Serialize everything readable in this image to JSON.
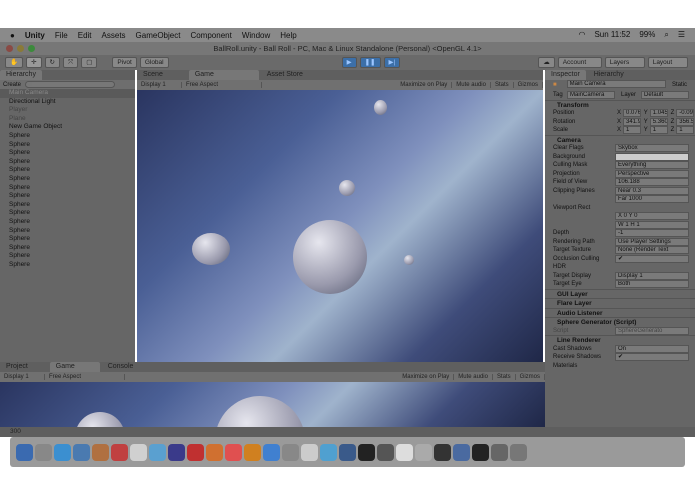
{
  "menubar": {
    "items": [
      "Unity",
      "File",
      "Edit",
      "Assets",
      "GameObject",
      "Component",
      "Window",
      "Help"
    ],
    "clock": "Sun 11:52",
    "battery": "99%"
  },
  "window_title": "BallRoll.unity - Ball Roll - PC, Mac & Linux Standalone (Personal) <OpenGL 4.1>",
  "toolbar": {
    "pivot": "Pivot",
    "global": "Global",
    "account": "Account",
    "layers": "Layers",
    "layout": "Layout"
  },
  "hierarchy": {
    "tab": "Hierarchy",
    "create": "Create",
    "search_placeholder": "All",
    "items": [
      "Main Camera",
      "Directional Light",
      "Player",
      "Plane",
      "New Game Object",
      "Sphere",
      "Sphere",
      "Sphere",
      "Sphere",
      "Sphere",
      "Sphere",
      "Sphere",
      "Sphere",
      "Sphere",
      "Sphere",
      "Sphere",
      "Sphere",
      "Sphere",
      "Sphere",
      "Sphere",
      "Sphere"
    ]
  },
  "center": {
    "tabs": [
      "Scene",
      "Game",
      "Asset Store"
    ],
    "display": "Display 1",
    "aspect": "Free Aspect",
    "buttons": [
      "Maximize on Play",
      "Mute audio",
      "Stats",
      "Gizmos"
    ]
  },
  "inspector": {
    "tabs": [
      "Inspector",
      "Hierarchy"
    ],
    "object_name": "Main Camera",
    "static": "Static",
    "tag_label": "Tag",
    "tag": "MainCamera",
    "layer_label": "Layer",
    "layer": "Default",
    "transform": {
      "title": "Transform",
      "position": [
        "0.0765",
        "1.0452",
        "-0.094"
      ],
      "rotation": [
        "341.95",
        "5.3601",
        "356.57"
      ],
      "scale": [
        "1",
        "1",
        "1"
      ],
      "labels": [
        "Position",
        "Rotation",
        "Scale"
      ]
    },
    "camera": {
      "title": "Camera",
      "rows": [
        [
          "Clear Flags",
          "Skybox"
        ],
        [
          "Background",
          ""
        ],
        [
          "Culling Mask",
          "Everything"
        ],
        [
          "Projection",
          "Perspective"
        ],
        [
          "Field of View",
          "106.188"
        ],
        [
          "Clipping Planes",
          "Near 0.3"
        ],
        [
          "",
          "Far 1000"
        ],
        [
          "Viewport Rect",
          ""
        ],
        [
          "",
          "X 0   Y 0"
        ],
        [
          "",
          "W 1   H 1"
        ],
        [
          "Depth",
          "-1"
        ],
        [
          "Rendering Path",
          "Use Player Settings"
        ],
        [
          "Target Texture",
          "None (Render Text"
        ],
        [
          "Occlusion Culling",
          "✔"
        ],
        [
          "HDR",
          ""
        ],
        [
          "Target Display",
          "Display 1"
        ],
        [
          "Target Eye",
          "Both"
        ]
      ]
    },
    "components": [
      "GUI Layer",
      "Flare Layer",
      "Audio Listener",
      "Sphere Generator (Script)"
    ],
    "script_label": "Script",
    "script_value": "SphereGenerato",
    "line_renderer": {
      "title": "Line Renderer",
      "rows": [
        [
          "Cast Shadows",
          "On"
        ],
        [
          "Receive Shadows",
          "✔"
        ],
        [
          "Materials",
          ""
        ]
      ]
    }
  },
  "lower": {
    "tabs": [
      "Project",
      "Game",
      "Console"
    ],
    "display": "Display 1",
    "aspect": "Free Aspect",
    "buttons": [
      "Maximize on Play",
      "Mute audio",
      "Stats",
      "Gizmos"
    ]
  },
  "status": "300"
}
